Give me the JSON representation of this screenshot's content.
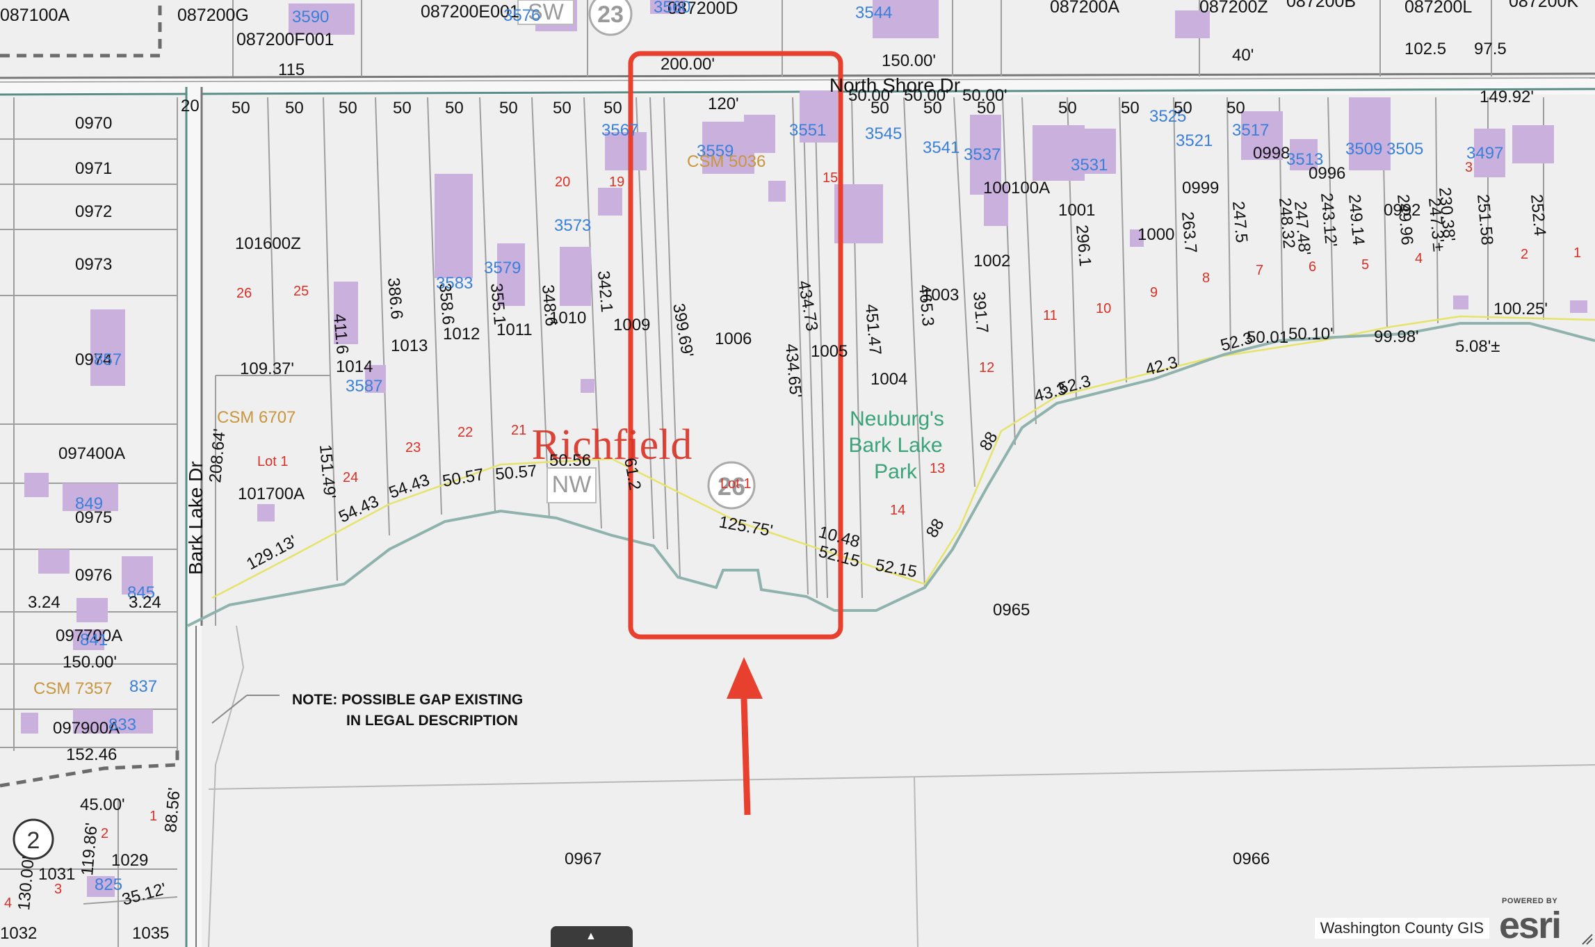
{
  "map": {
    "town_name": "Richfield",
    "roads": {
      "north": "North Shore Dr",
      "west": "Bark Lake Dr"
    },
    "park_label": [
      "Neuburg's",
      "Bark Lake",
      "Park"
    ],
    "note_lines": [
      "NOTE: POSSIBLE GAP EXISTING",
      "IN LEGAL DESCRIPTION"
    ],
    "attribution": "Washington County GIS",
    "esri": {
      "powered": "POWERED BY",
      "logo": "esri"
    },
    "colors": {
      "highlight": "#e8402e",
      "parcel_line": "#9e9e9e",
      "shoreline": "#8fb2ac",
      "address": "#3a7fd8",
      "lot_number": "#d93025",
      "csm": "#c8963e",
      "building": "#c9b0dd",
      "park": "#3aa37a"
    },
    "parcels_top": [
      {
        "id": "087100A"
      },
      {
        "id": "087200G"
      },
      {
        "id": "087200E001"
      },
      {
        "id": "087200D"
      },
      {
        "id": "087200A"
      },
      {
        "id": "087200Z"
      },
      {
        "id": "087200B"
      },
      {
        "id": "087200L"
      },
      {
        "id": "087200K"
      },
      {
        "id": "087200F001"
      }
    ],
    "parcels_main": [
      "101600Z",
      "1014",
      "1013",
      "1012",
      "1011",
      "1010",
      "1009",
      "1006",
      "1005",
      "1004",
      "1003",
      "1002",
      "100100A",
      "1001",
      "1000",
      "0999",
      "0998",
      "0996",
      "0992"
    ],
    "parcels_west": [
      "0970",
      "0971",
      "0972",
      "0973",
      "0974",
      "097400A",
      "0975",
      "0976",
      "097700A",
      "097900A",
      "1031",
      "1029",
      "1035",
      "1032",
      "101700A"
    ],
    "parcels_south": [
      "0965",
      "0967",
      "0966"
    ],
    "addresses": [
      "3590",
      "3576",
      "3560",
      "3544",
      "3567",
      "3559",
      "3551",
      "3545",
      "3541",
      "3537",
      "3531",
      "3525",
      "3521",
      "3517",
      "3513",
      "3509",
      "3505",
      "3497",
      "3573",
      "3583",
      "3579",
      "3587",
      "857",
      "849",
      "845",
      "841",
      "837",
      "833",
      "825"
    ],
    "csm_labels": [
      "CSM 5036",
      "CSM 6707",
      "CSM 7357"
    ],
    "lot_labels": [
      "Lot 1",
      "Lot 1"
    ],
    "lot_numbers": [
      "26",
      "25",
      "24",
      "23",
      "22",
      "21",
      "20",
      "19",
      "15",
      "14",
      "13",
      "12",
      "11",
      "10",
      "9",
      "8",
      "7",
      "6",
      "5",
      "4",
      "3",
      "2",
      "1",
      "1",
      "2",
      "3",
      "4"
    ],
    "dimensions": [
      "200.00'",
      "150.00'",
      "115",
      "102.5",
      "97.5",
      "40'",
      "120'",
      "399.69'",
      "434.65'",
      "434.73",
      "451.47",
      "465.3",
      "391.7",
      "296.1",
      "263.7",
      "247.5",
      "248.32",
      "247.48'",
      "243.12'",
      "249.14",
      "249.96",
      "247.3'±",
      "230.38'",
      "251.58",
      "252.4",
      "411.6",
      "386.6",
      "358.6",
      "355.1",
      "348.6",
      "342.1",
      "151.49'",
      "208.64'",
      "109.37'",
      "129.13'",
      "54.43",
      "54.43",
      "50.57",
      "50.57",
      "50.56",
      "61.2",
      "125.75'",
      "10.48",
      "52.15",
      "52.15",
      "88",
      "88",
      "43.3",
      "52.3",
      "42.3",
      "52.3",
      "50.01",
      "50.10'",
      "99.98'",
      "100.25'",
      "5.08'±",
      "149.92'",
      "50.00'",
      "50.00'",
      "50.00'",
      "45.00'",
      "130.00'",
      "119.86'",
      "88.56'",
      "35.12'",
      "150.00'",
      "152.46",
      "3.24",
      "3.24",
      "20"
    ],
    "section_markers": [
      "23",
      "26",
      "2"
    ],
    "section_label": "NW"
  }
}
